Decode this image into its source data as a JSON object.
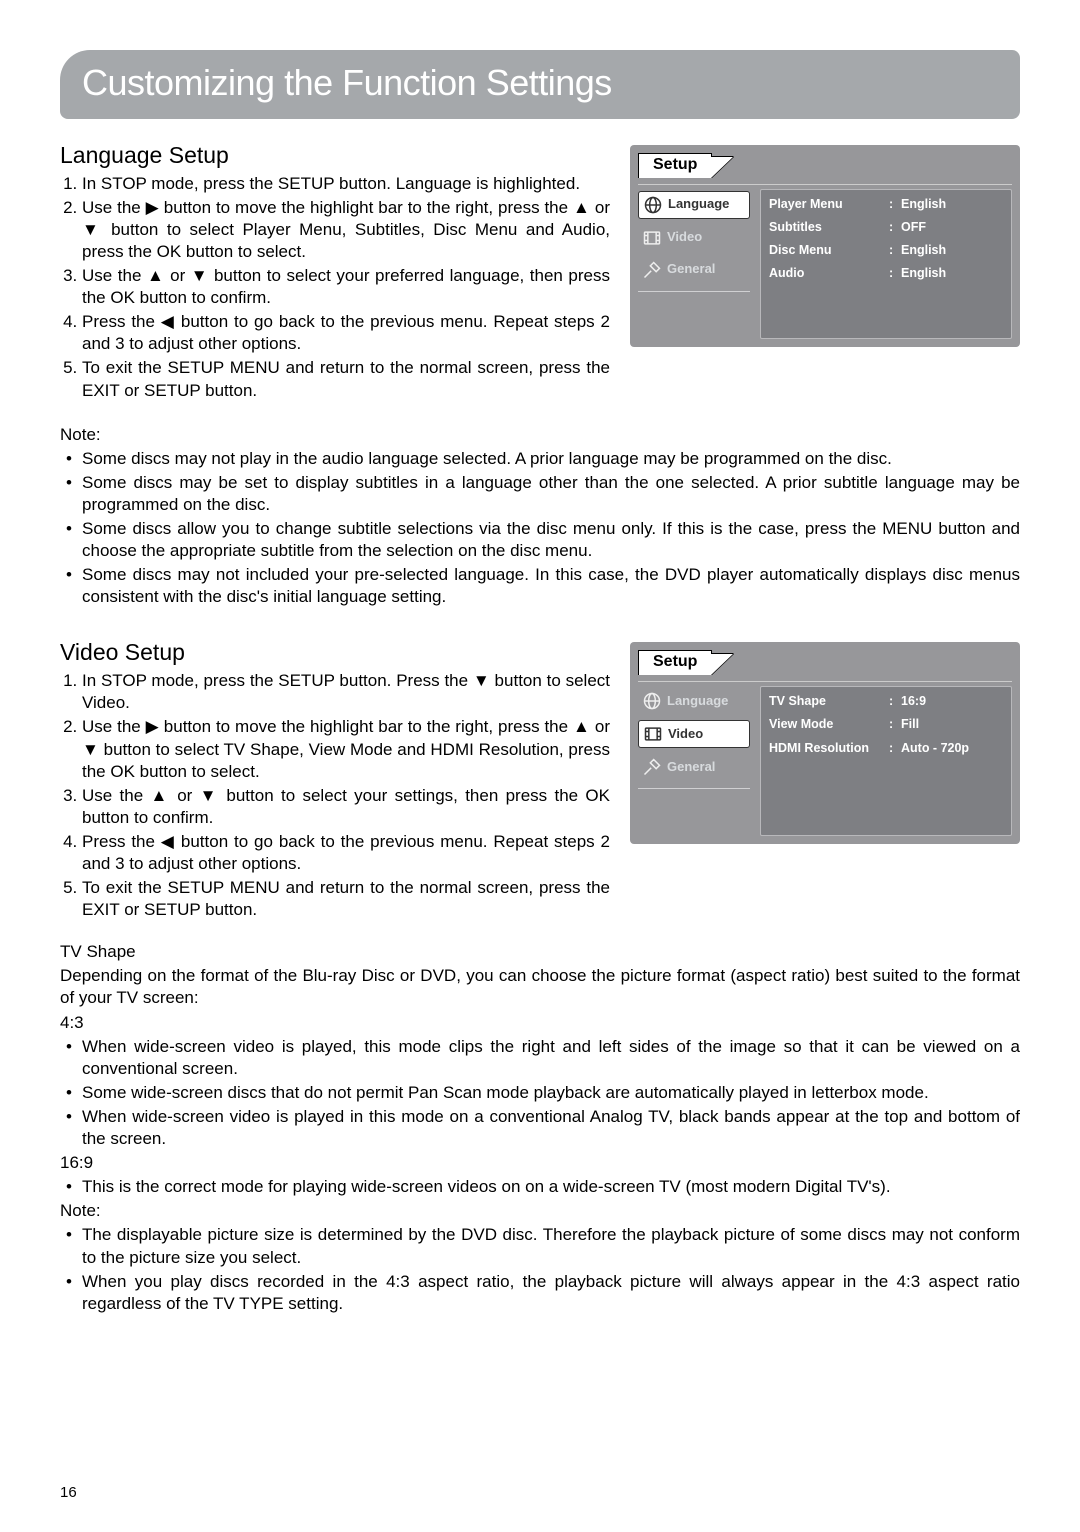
{
  "page_number": "16",
  "title": "Customizing the Function Settings",
  "language_setup": {
    "heading": "Language Setup",
    "steps": [
      "In STOP mode, press the SETUP button. Language is highlighted.",
      "Use the ▶ button to move the highlight bar to the right, press the ▲ or ▼ button to select Player Menu, Subtitles, Disc Menu and Audio, press the OK button to select.",
      "Use the ▲ or ▼ button to select your preferred language, then press the OK button to confirm.",
      "Press the ◀ button to go back to the previous menu. Repeat steps 2 and 3 to adjust other options.",
      "To exit the SETUP MENU and return to the normal screen, press the EXIT or SETUP button."
    ],
    "note_label": "Note:",
    "notes": [
      "Some discs may not play in the audio language selected. A prior language may be programmed on the disc.",
      "Some discs may be set to display subtitles in a language other than the one selected. A prior subtitle language may be programmed on the disc.",
      "Some discs allow you to change subtitle selections via the disc menu only. If this is the case, press the MENU button and choose the appropriate subtitle from the selection on the disc menu.",
      "Some discs may not included your pre-selected language. In this case, the DVD player automatically displays disc menus consistent with the disc's initial language setting."
    ]
  },
  "video_setup": {
    "heading": "Video Setup",
    "steps": [
      "In STOP mode, press the SETUP button. Press the ▼ button to select Video.",
      "Use the ▶ button to move the highlight bar to the right, press the ▲ or ▼ button to select TV Shape, View Mode and HDMI Resolution, press the OK button to select.",
      "Use the ▲ or ▼ button to select your settings, then press the OK button to confirm.",
      "Press the ◀ button to go back to the previous menu. Repeat steps 2 and 3 to adjust other options.",
      "To exit the SETUP MENU and return to the normal screen, press the EXIT or SETUP button."
    ],
    "tvshape_heading": "TV Shape",
    "tvshape_intro": "Depending  on the format of the Blu-ray Disc or DVD, you can choose the picture format (aspect ratio) best suited to the format of your TV screen:",
    "ratio_43_label": "4:3",
    "ratio_43_bullets": [
      "When wide-screen video is played, this mode clips the right and left sides of the image so that it can be viewed on a conventional screen.",
      "Some wide-screen discs that do not permit Pan Scan mode playback are automatically played in letterbox mode.",
      "When wide-screen video is played in this mode on a conventional Analog TV, black bands appear at the top and bottom of the screen."
    ],
    "ratio_169_label": "16:9",
    "ratio_169_bullets": [
      "This is the correct mode for playing wide-screen videos on on a wide-screen TV (most modern Digital TV's)."
    ],
    "note_label": "Note:",
    "notes": [
      "The displayable picture size is determined by the DVD disc. Therefore the playback picture of some discs may not conform to the picture size you select.",
      "When you play discs recorded in the 4:3 aspect ratio, the playback picture will always appear in the 4:3 aspect ratio regardless of the TV TYPE setting."
    ]
  },
  "panel_common": {
    "title": "Setup",
    "sidebar": {
      "language": "Language",
      "video": "Video",
      "general": "General"
    }
  },
  "panel1": {
    "rows": [
      {
        "k": "Player Menu",
        "v": "English"
      },
      {
        "k": "Subtitles",
        "v": "OFF"
      },
      {
        "k": "Disc Menu",
        "v": "English"
      },
      {
        "k": "Audio",
        "v": "English"
      }
    ]
  },
  "panel2": {
    "rows": [
      {
        "k": "TV Shape",
        "v": "16:9"
      },
      {
        "k": "View Mode",
        "v": "Fill"
      },
      {
        "k": "HDMI Resolution",
        "v": "Auto - 720p"
      }
    ]
  }
}
